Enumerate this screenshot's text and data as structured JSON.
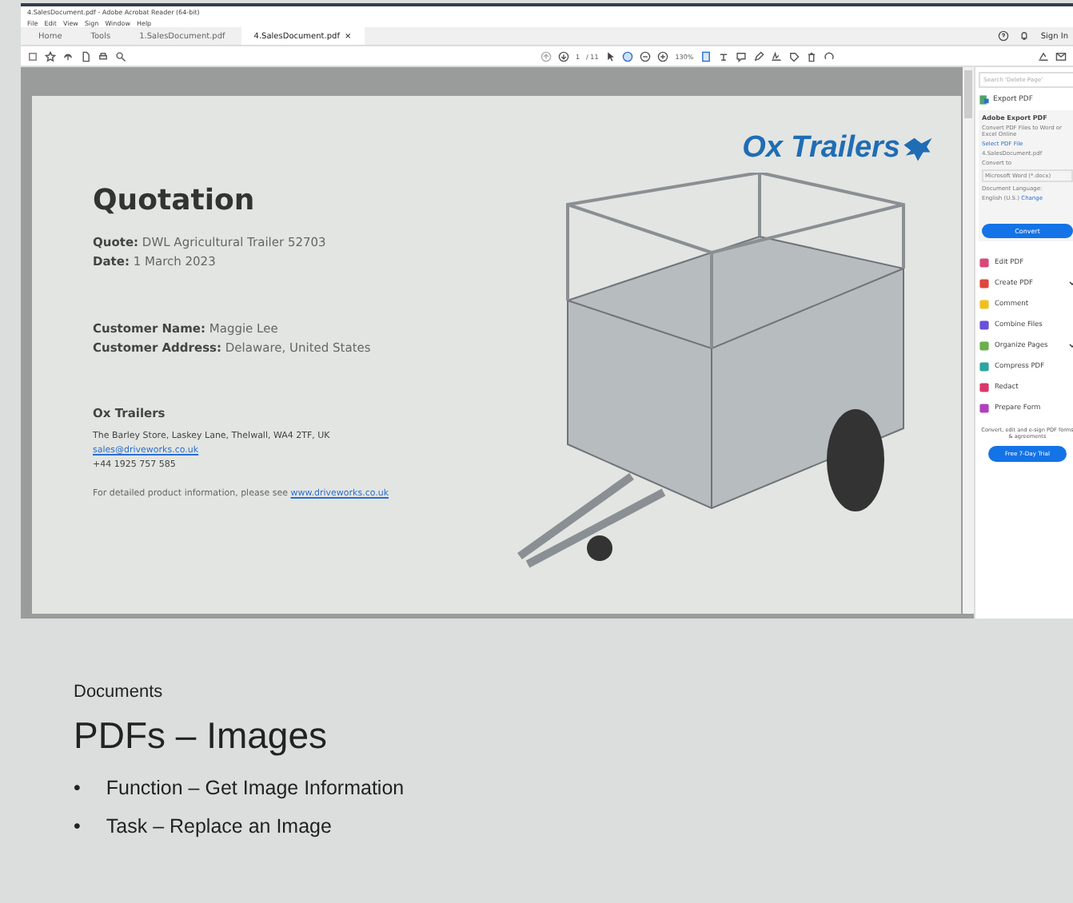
{
  "window": {
    "title": "4.SalesDocument.pdf - Adobe Acrobat Reader (64-bit)",
    "menu": [
      "File",
      "Edit",
      "View",
      "Sign",
      "Window",
      "Help"
    ]
  },
  "tabs": [
    {
      "label": "Home",
      "selected": false
    },
    {
      "label": "Tools",
      "selected": false
    },
    {
      "label": "1.SalesDocument.pdf",
      "selected": false
    },
    {
      "label": "4.SalesDocument.pdf",
      "selected": true,
      "close": "×"
    }
  ],
  "sign_in": "Sign In",
  "toolbar": {
    "page": "1",
    "page_count": "/ 11",
    "zoom": "130%"
  },
  "document": {
    "logo": "Ox Trailers",
    "title": "Quotation",
    "fields": [
      {
        "label": "Quote:",
        "value": "DWL Agricultural Trailer 52703"
      },
      {
        "label": "Date:",
        "value": "1 March 2023"
      }
    ],
    "customer": [
      {
        "label": "Customer Name:",
        "value": "Maggie Lee"
      },
      {
        "label": "Customer Address:",
        "value": "Delaware, United States"
      }
    ],
    "company": "Ox Trailers",
    "address": "The Barley Store, Laskey Lane, Thelwall, WA4 2TF, UK",
    "email": "sales@driveworks.co.uk",
    "phone": "+44 1925 757 585",
    "info": "For detailed product information, please see",
    "info_link": "www.driveworks.co.uk"
  },
  "panel": {
    "search_placeholder": "Search 'Delete Page'",
    "export": {
      "title": "Export PDF",
      "heading": "Adobe Export PDF",
      "desc": "Convert PDF Files to Word or Excel Online",
      "select_label": "Select PDF File",
      "file": "4.SalesDocument.pdf",
      "convert_label": "Convert to",
      "format": "Microsoft Word (*.docx)",
      "lang_label": "Document Language:",
      "lang": "English (U.S.)",
      "change": "Change",
      "button": "Convert"
    },
    "tools": [
      {
        "label": "Edit PDF",
        "color": "#d9477a",
        "expandable": false
      },
      {
        "label": "Create PDF",
        "color": "#e0473c",
        "expandable": true
      },
      {
        "label": "Comment",
        "color": "#f0c020",
        "expandable": false
      },
      {
        "label": "Combine Files",
        "color": "#6a4fd8",
        "expandable": false
      },
      {
        "label": "Organize Pages",
        "color": "#6ab04c",
        "expandable": true
      },
      {
        "label": "Compress PDF",
        "color": "#2aa5a0",
        "expandable": false
      },
      {
        "label": "Redact",
        "color": "#d8386a",
        "expandable": false
      },
      {
        "label": "Prepare Form",
        "color": "#b040c0",
        "expandable": false
      }
    ],
    "promo": "Convert, edit and e-sign PDF forms & agreements",
    "trial": "Free 7-Day Trial"
  },
  "slide": {
    "section": "Documents",
    "title": "PDFs – Images",
    "bullets": [
      {
        "marker": "•",
        "text": "Function – Get Image Information"
      },
      {
        "marker": "•",
        "text": "Task – Replace an Image"
      }
    ]
  }
}
